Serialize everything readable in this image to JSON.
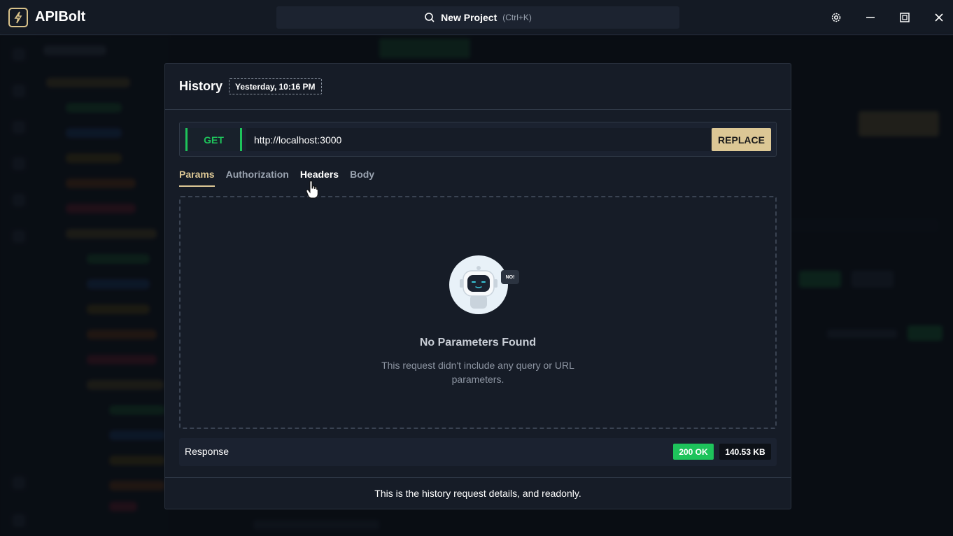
{
  "app": {
    "name": "APIBolt"
  },
  "search": {
    "label": "New Project",
    "shortcut": "(Ctrl+K)"
  },
  "window_controls": [
    "gear-icon",
    "minimize-icon",
    "maximize-icon",
    "close-icon"
  ],
  "modal": {
    "title": "History",
    "timestamp": "Yesterday, 10:16 PM",
    "request": {
      "method": "GET",
      "url": "http://localhost:3000",
      "replace_label": "REPLACE"
    },
    "tabs": [
      {
        "label": "Params",
        "active": true
      },
      {
        "label": "Authorization",
        "active": false
      },
      {
        "label": "Headers",
        "active": false
      },
      {
        "label": "Body",
        "active": false
      }
    ],
    "empty_state": {
      "badge": "NO!",
      "title": "No Parameters Found",
      "description": "This request didn't include any query or URL parameters."
    },
    "response": {
      "label": "Response",
      "status": "200 OK",
      "size": "140.53 KB"
    },
    "footer": "This is the history request details, and readonly."
  },
  "colors": {
    "accent": "#dcc795",
    "success": "#1ec35b",
    "background": "#0d1117"
  }
}
